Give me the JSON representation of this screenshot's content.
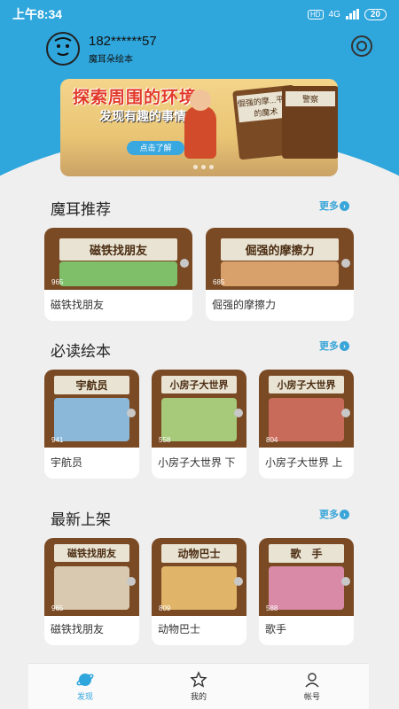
{
  "status_bar": {
    "time": "上午8:34",
    "hd": "HD",
    "network": "4G",
    "battery": "20"
  },
  "profile": {
    "phone": "182******57",
    "app_name": "魔耳朵绘本"
  },
  "banner": {
    "title": "探索周围的环境",
    "subtitle": "发现有趣的事情",
    "cta": "点击了解",
    "book1": "倔强的摩...平衡的魔术",
    "book2": "警察"
  },
  "sections": [
    {
      "title": "魔耳推荐",
      "more": "更多",
      "books": [
        {
          "cover": "磁铁找朋友",
          "count": "965",
          "label": "磁铁找朋友",
          "pic_color": "#7fbf6a"
        },
        {
          "cover": "倔强的摩擦力",
          "count": "685",
          "label": "倔强的摩擦力",
          "pic_color": "#d8a06a"
        }
      ]
    },
    {
      "title": "必读绘本",
      "more": "更多",
      "books": [
        {
          "cover": "宇航员",
          "count": "941",
          "label": "宇航员",
          "pic_color": "#8bb8d9"
        },
        {
          "cover": "小房子大世界",
          "count": "558",
          "label": "小房子大世界 下",
          "pic_color": "#a7c97a"
        },
        {
          "cover": "小房子大世界",
          "count": "804",
          "label": "小房子大世界 上",
          "pic_color": "#c96b5a"
        }
      ]
    },
    {
      "title": "最新上架",
      "more": "更多",
      "books": [
        {
          "cover": "磁铁找朋友",
          "count": "965",
          "label": "磁铁找朋友",
          "pic_color": "#d9c9b0"
        },
        {
          "cover": "动物巴士",
          "count": "809",
          "label": "动物巴士",
          "pic_color": "#e0b56a"
        },
        {
          "cover": "歌　手",
          "count": "588",
          "label": "歌手",
          "pic_color": "#d98aa6"
        }
      ]
    }
  ],
  "tabs": [
    {
      "label": "发现",
      "active": true
    },
    {
      "label": "我的",
      "active": false
    },
    {
      "label": "帐号",
      "active": false
    }
  ]
}
